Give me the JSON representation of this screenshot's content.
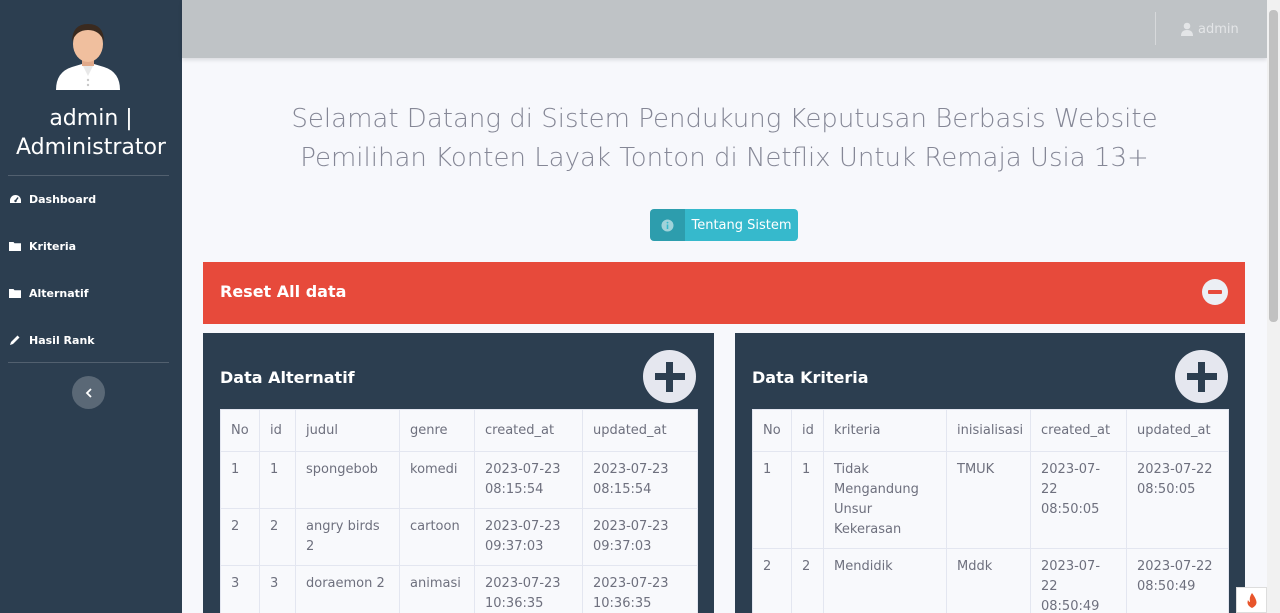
{
  "sidebar": {
    "user_line1": "admin |",
    "user_line2": "Administrator",
    "items": [
      {
        "label": "Dashboard",
        "icon": "tachometer-icon"
      },
      {
        "label": "Kriteria",
        "icon": "folder-icon"
      },
      {
        "label": "Alternatif",
        "icon": "folder-icon"
      },
      {
        "label": "Hasil Rank",
        "icon": "pencil-icon"
      }
    ]
  },
  "topbar": {
    "user_name": "admin"
  },
  "main": {
    "welcome_line1": "Selamat Datang di Sistem Pendukung Keputusan Berbasis Website",
    "welcome_line2": "Pemilihan Konten Layak Tonton di Netflix Untuk Remaja Usia 13+",
    "about_button": "Tentang Sistem",
    "reset_title": "Reset All data"
  },
  "alternatif": {
    "title": "Data Alternatif",
    "headers": [
      "No",
      "id",
      "judul",
      "genre",
      "created_at",
      "updated_at"
    ],
    "rows": [
      [
        "1",
        "1",
        "spongebob",
        "komedi",
        "2023-07-23 08:15:54",
        "2023-07-23 08:15:54"
      ],
      [
        "2",
        "2",
        "angry birds 2",
        "cartoon",
        "2023-07-23 09:37:03",
        "2023-07-23 09:37:03"
      ],
      [
        "3",
        "3",
        "doraemon 2",
        "animasi",
        "2023-07-23 10:36:35",
        "2023-07-23 10:36:35"
      ]
    ]
  },
  "kriteria": {
    "title": "Data Kriteria",
    "headers": [
      "No",
      "id",
      "kriteria",
      "inisialisasi",
      "created_at",
      "updated_at"
    ],
    "rows": [
      [
        "1",
        "1",
        "Tidak Mengandung Unsur Kekerasan",
        "TMUK",
        "2023-07-22 08:50:05",
        "2023-07-22 08:50:05"
      ],
      [
        "2",
        "2",
        "Mendidik",
        "Mddk",
        "2023-07-22 08:50:49",
        "2023-07-22 08:50:49"
      ]
    ]
  },
  "colors": {
    "sidebar": "#2c3e50",
    "danger": "#e74a3b",
    "info": "#36b9cc"
  }
}
